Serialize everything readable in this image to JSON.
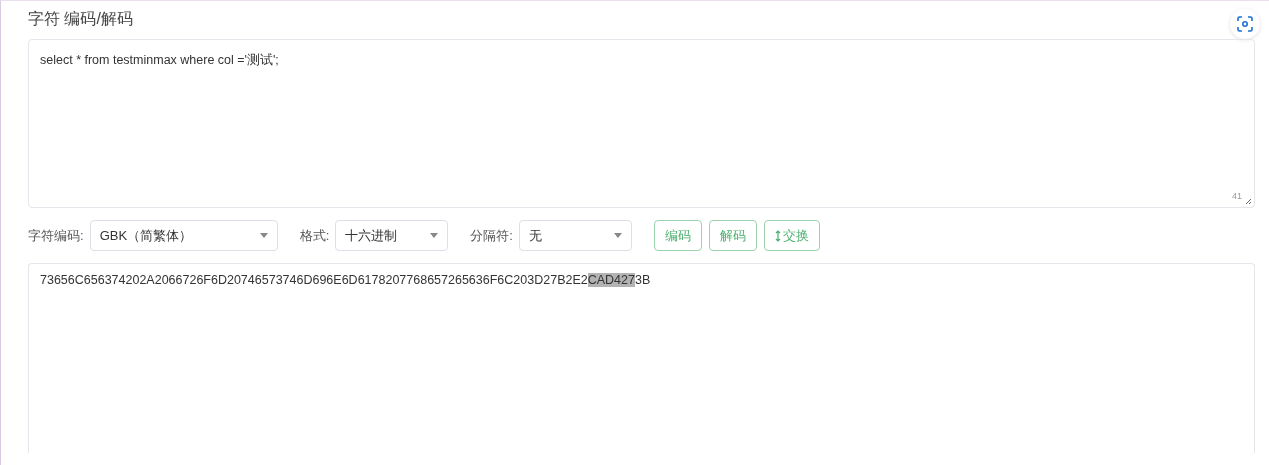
{
  "title": "字符 编码/解码",
  "input": {
    "value": "select * from testminmax where col ='测试';",
    "char_count": "41"
  },
  "controls": [
    {
      "kind": "select",
      "label": "字符编码:",
      "value": "GBK（简繁体）"
    },
    {
      "kind": "select",
      "label": "格式:",
      "value": "十六进制"
    },
    {
      "kind": "select",
      "label": "分隔符:",
      "value": "无"
    }
  ],
  "buttons": [
    {
      "label": "编码",
      "kind": "plain"
    },
    {
      "label": "解码",
      "kind": "plain"
    },
    {
      "label": "交换",
      "kind": "swap"
    }
  ],
  "output": {
    "segments": [
      {
        "text": "73656C656374202A2066726F6D20746573746D696E6D6178207768657265636F6C203D27B2E2",
        "selected": false
      },
      {
        "text": "CAD427",
        "selected": true
      },
      {
        "text": "3B",
        "selected": false
      }
    ]
  }
}
